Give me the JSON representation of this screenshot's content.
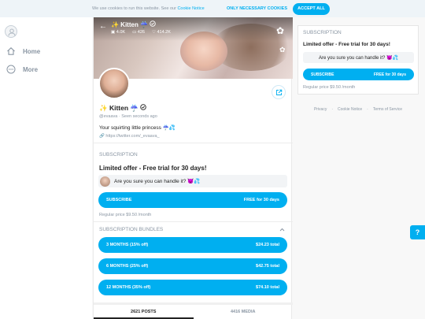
{
  "cookie": {
    "text": "We use cookies to run this website. See our",
    "link": "Cookie Notice",
    "only_necessary": "ONLY NECESSARY COOKIES",
    "accept": "ACCEPT ALL"
  },
  "sidebar": {
    "items": [
      {
        "label": "Home",
        "icon": "home-icon"
      },
      {
        "label": "More",
        "icon": "more-icon"
      }
    ]
  },
  "profile": {
    "cover_title": "✨ Kitten ☔",
    "stats": {
      "photos": "4.0K",
      "videos": "426",
      "likes": "414.2K"
    },
    "name": "✨ Kitten ☔",
    "handle": "@evaava",
    "seen": "Seen  seconds ago",
    "bio": "Your squirting little princess ☔💦",
    "url": "https://twitter.com/_evaava_"
  },
  "subscription": {
    "header": "SUBSCRIPTION",
    "offer": "Limited offer - Free trial for 30 days!",
    "message": "Are you sure you can handle it? 😈💦",
    "subscribe": "SUBSCRIBE",
    "subscribe_price": "FREE for 30 days",
    "regular": "Regular price $9.50 /month"
  },
  "bundles": {
    "header": "SUBSCRIPTION BUNDLES",
    "items": [
      {
        "label": "3 MONTHS (15% off)",
        "price": "$24.23 total"
      },
      {
        "label": "6 MONTHS (25% off)",
        "price": "$42.75 total"
      },
      {
        "label": "12 MONTHS (35% off)",
        "price": "$74.10 total"
      }
    ]
  },
  "tabs": [
    {
      "label": "2621 POSTS"
    },
    {
      "label": "4416 MEDIA"
    }
  ],
  "right_card": {
    "header": "SUBSCRIPTION",
    "offer": "Limited offer - Free trial for 30 days!",
    "message": "Are you sure you can handle it? 😈💦",
    "subscribe": "SUBSCRIBE",
    "subscribe_price": "FREE for 30 days",
    "regular": "Regular price $9.50 /month"
  },
  "footer_links": [
    "Privacy",
    "Cookie Notice",
    "Terms of Service"
  ],
  "help": "?",
  "accent": "#00aff0"
}
